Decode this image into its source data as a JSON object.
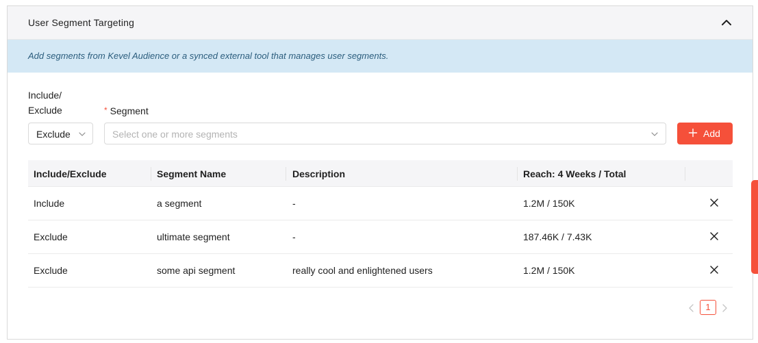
{
  "panel": {
    "title": "User Segment Targeting",
    "collapse_icon": "chevron-up-icon"
  },
  "info": {
    "text": "Add segments from Kevel Audience or a synced external tool that manages user segments."
  },
  "form": {
    "include_exclude_label_line1": "Include/",
    "include_exclude_label_line2": "Exclude",
    "required_marker": "*",
    "segment_label": "Segment",
    "include_exclude_value": "Exclude",
    "segment_placeholder": "Select one or more segments",
    "add_label": "Add",
    "add_icon": "plus-icon"
  },
  "table": {
    "columns": [
      "Include/Exclude",
      "Segment Name",
      "Description",
      "Reach: 4 Weeks / Total"
    ],
    "rows": [
      {
        "include_exclude": "Include",
        "name": "a segment",
        "description": "-",
        "reach": "1.2M / 150K"
      },
      {
        "include_exclude": "Exclude",
        "name": "ultimate segment",
        "description": "-",
        "reach": "187.46K / 7.43K"
      },
      {
        "include_exclude": "Exclude",
        "name": "some api segment",
        "description": "really cool and enlightened users",
        "reach": "1.2M / 150K"
      }
    ],
    "remove_icon": "close-icon"
  },
  "pagination": {
    "current_page": "1"
  },
  "colors": {
    "accent": "#f5503a",
    "banner_bg": "#d4e8f5",
    "banner_text": "#2b5d7d",
    "header_bg": "#f5f5f7"
  }
}
